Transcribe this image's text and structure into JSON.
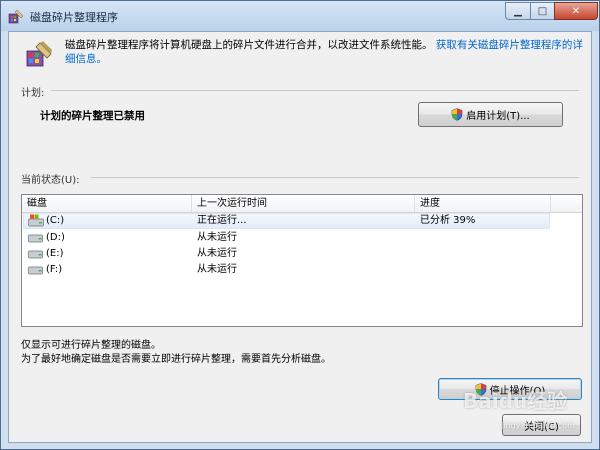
{
  "window": {
    "title": "磁盘碎片整理程序",
    "minimize_glyph": "▁",
    "maximize_glyph": "□",
    "close_glyph": "✕"
  },
  "intro": {
    "text": "磁盘碎片整理程序将计算机硬盘上的碎片文件进行合并，以改进文件系统性能。",
    "link": "获取有关磁盘碎片整理程序的详细信息。"
  },
  "schedule": {
    "section_label": "计划:",
    "status": "计划的碎片整理已禁用",
    "enable_button": "启用计划(T)..."
  },
  "current_status": {
    "section_label": "当前状态(U):",
    "columns": [
      "磁盘",
      "上一次运行时间",
      "进度"
    ],
    "rows": [
      {
        "disk": "(C:)",
        "last_run": "正在运行...",
        "progress": "已分析 39%",
        "icon": "system-drive-icon"
      },
      {
        "disk": "(D:)",
        "last_run": "从未运行",
        "progress": "",
        "icon": "drive-icon"
      },
      {
        "disk": "(E:)",
        "last_run": "从未运行",
        "progress": "",
        "icon": "drive-icon"
      },
      {
        "disk": "(F:)",
        "last_run": "从未运行",
        "progress": "",
        "icon": "drive-icon"
      }
    ]
  },
  "notes": {
    "line1": "仅显示可进行碎片整理的磁盘。",
    "line2": "为了最好地确定磁盘是否需要立即进行碎片整理，需要首先分析磁盘。"
  },
  "buttons": {
    "stop": "停止操作(O)",
    "close": "关闭(C)"
  },
  "watermark": {
    "main": "Baidu经验",
    "sub": "jingyan.baidu.com"
  },
  "colors": {
    "link": "#0066cc",
    "title_bar": "#c9dcf1",
    "close_button": "#c7452f"
  }
}
